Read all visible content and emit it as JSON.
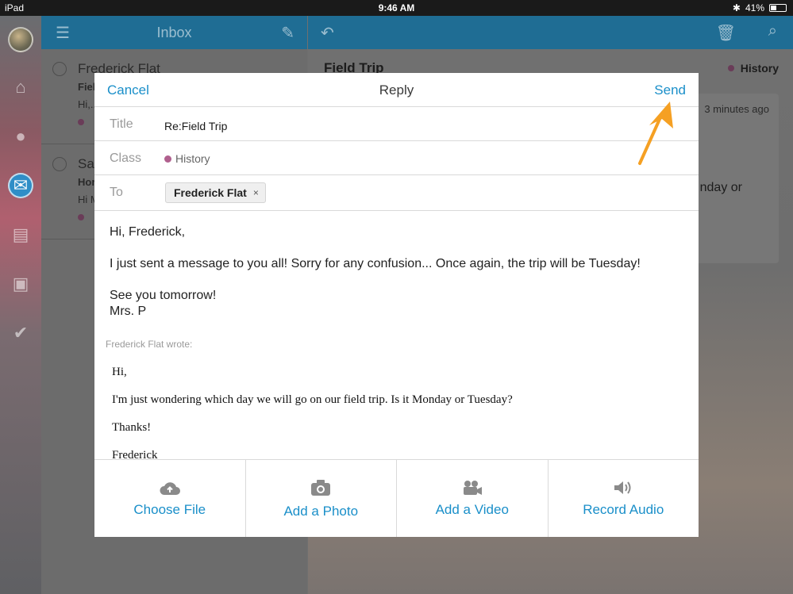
{
  "status_bar": {
    "device": "iPad",
    "time": "9:46 AM",
    "battery": "41%",
    "battery_level": 0.41
  },
  "inbox": {
    "title": "Inbox",
    "items": [
      {
        "sender": "Frederick Flat",
        "subject": "Fiel",
        "preview": "Hi,..."
      },
      {
        "sender": "Sa",
        "subject": "Hor",
        "preview": "Hi M"
      }
    ]
  },
  "reading": {
    "subject": "Field Trip",
    "class_name": "History",
    "time": "3 minutes ago",
    "snippet": "nday or"
  },
  "compose": {
    "cancel_label": "Cancel",
    "title": "Reply",
    "send_label": "Send",
    "fields": {
      "title_label": "Title",
      "title_value": "Re:Field Trip",
      "class_label": "Class",
      "class_value": "History",
      "to_label": "To",
      "recipient": "Frederick Flat",
      "remove_symbol": "×"
    },
    "body": {
      "greeting": "Hi, Frederick,",
      "paragraph": "I just sent a message to you all! Sorry for any confusion... Once again, the trip will be Tuesday!",
      "closing": "See you tomorrow!",
      "signature": "Mrs. P"
    },
    "quoted": {
      "header": "Frederick Flat wrote:",
      "lines": [
        "Hi,",
        "I'm just wondering which day we will go on our field trip. Is it Monday or Tuesday?",
        "Thanks!",
        "Frederick"
      ]
    },
    "actions": [
      {
        "label": "Choose File",
        "icon": "cloud-upload-icon"
      },
      {
        "label": "Add a Photo",
        "icon": "camera-icon"
      },
      {
        "label": "Add a Video",
        "icon": "video-camera-icon"
      },
      {
        "label": "Record Audio",
        "icon": "speaker-icon"
      }
    ]
  },
  "colors": {
    "accent": "#1a8fc9",
    "header_bar": "#1f6d94",
    "class_dot": "#b0608e",
    "arrow": "#f5a023"
  }
}
